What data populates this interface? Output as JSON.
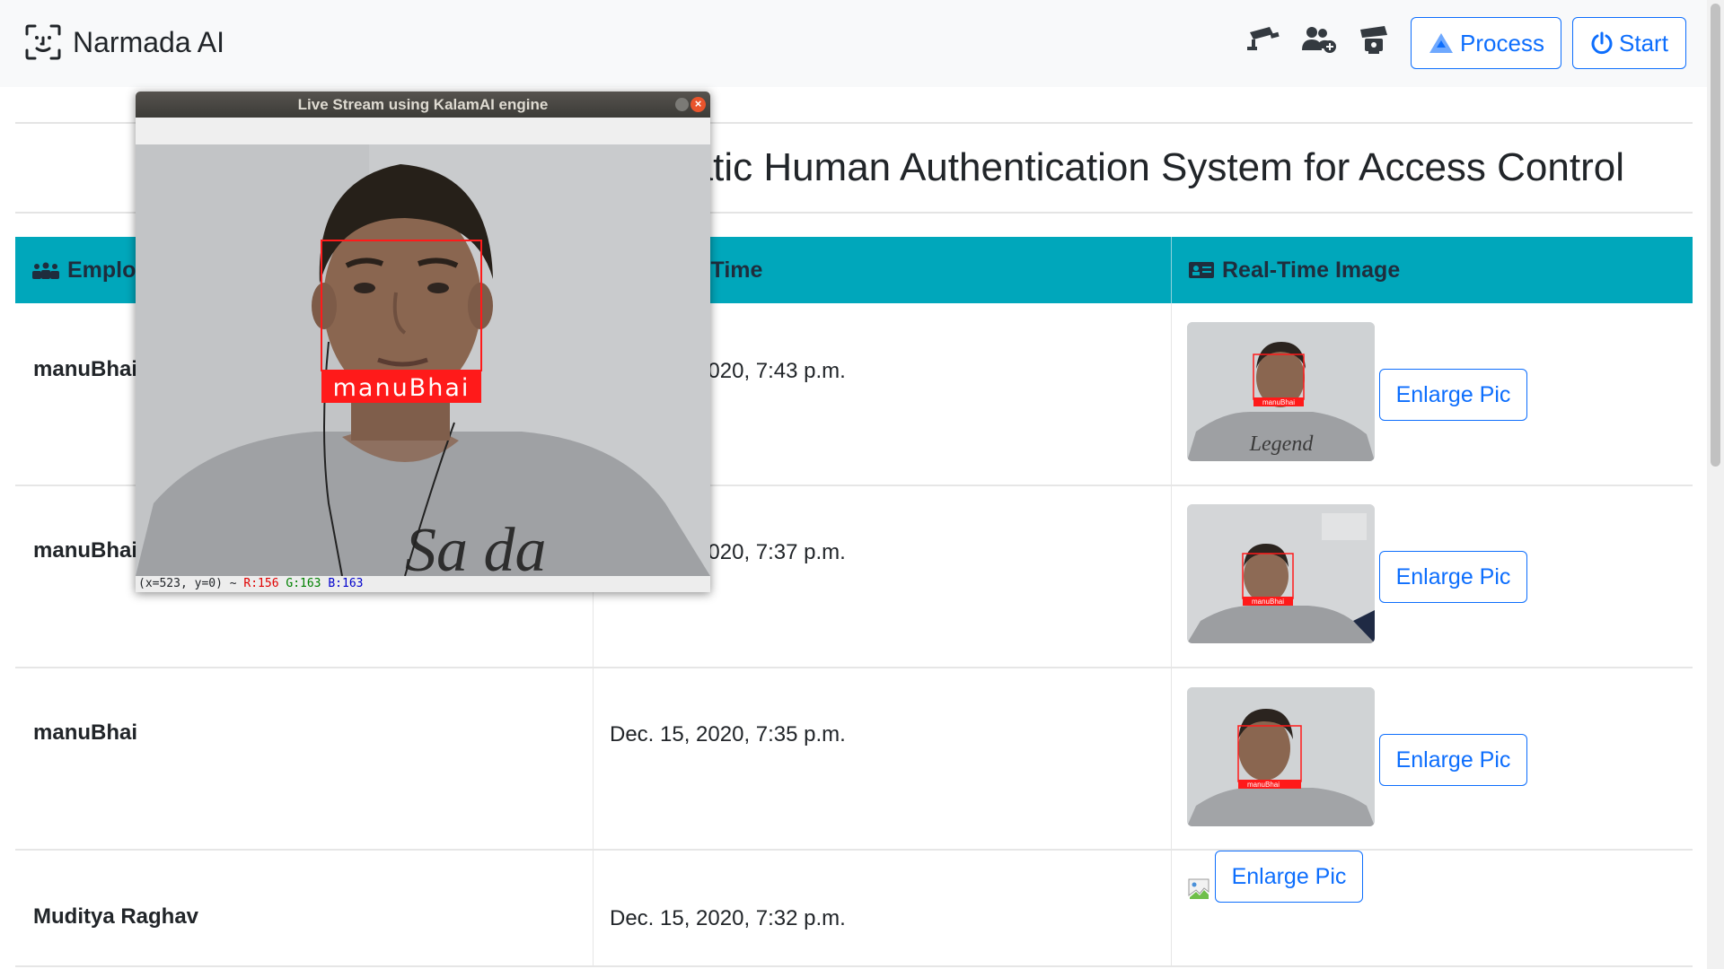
{
  "navbar": {
    "brand": "Narmada AI",
    "icons": [
      "cctv-camera-icon",
      "add-user-icon",
      "camera-settings-icon"
    ],
    "process_label": "Process",
    "start_label": "Start"
  },
  "page": {
    "title": "Automatic Human Authentication System for Access Control"
  },
  "table": {
    "headers": {
      "employee": "Employee",
      "date_time": "Date and Time",
      "image": "Real-Time Image"
    },
    "rows": [
      {
        "name": "manuBhai",
        "datetime": "Dec. 15, 2020, 7:43 p.m.",
        "enlarge": "Enlarge Pic",
        "image_tag": "manuBhai"
      },
      {
        "name": "manuBhai",
        "datetime": "Dec. 15, 2020, 7:37 p.m.",
        "enlarge": "Enlarge Pic",
        "image_tag": "manuBhai"
      },
      {
        "name": "manuBhai",
        "datetime": "Dec. 15, 2020, 7:35 p.m.",
        "enlarge": "Enlarge Pic",
        "image_tag": "manuBhai"
      },
      {
        "name": "Muditya Raghav",
        "datetime": "Dec. 15, 2020, 7:32 p.m.",
        "enlarge": "Enlarge Pic",
        "image_tag": ""
      }
    ]
  },
  "stream_window": {
    "title": "Live Stream using KalamAI engine",
    "face_label": "manuBhai",
    "status": {
      "coords": "(x=523, y=0) ~",
      "r": "R:156",
      "g": "G:163",
      "b": "B:163"
    }
  },
  "colors": {
    "navbar_bg": "#f8f9fa",
    "accent": "#0d6efd",
    "table_header": "#00a7bb",
    "face_box": "#ff1a1a"
  }
}
